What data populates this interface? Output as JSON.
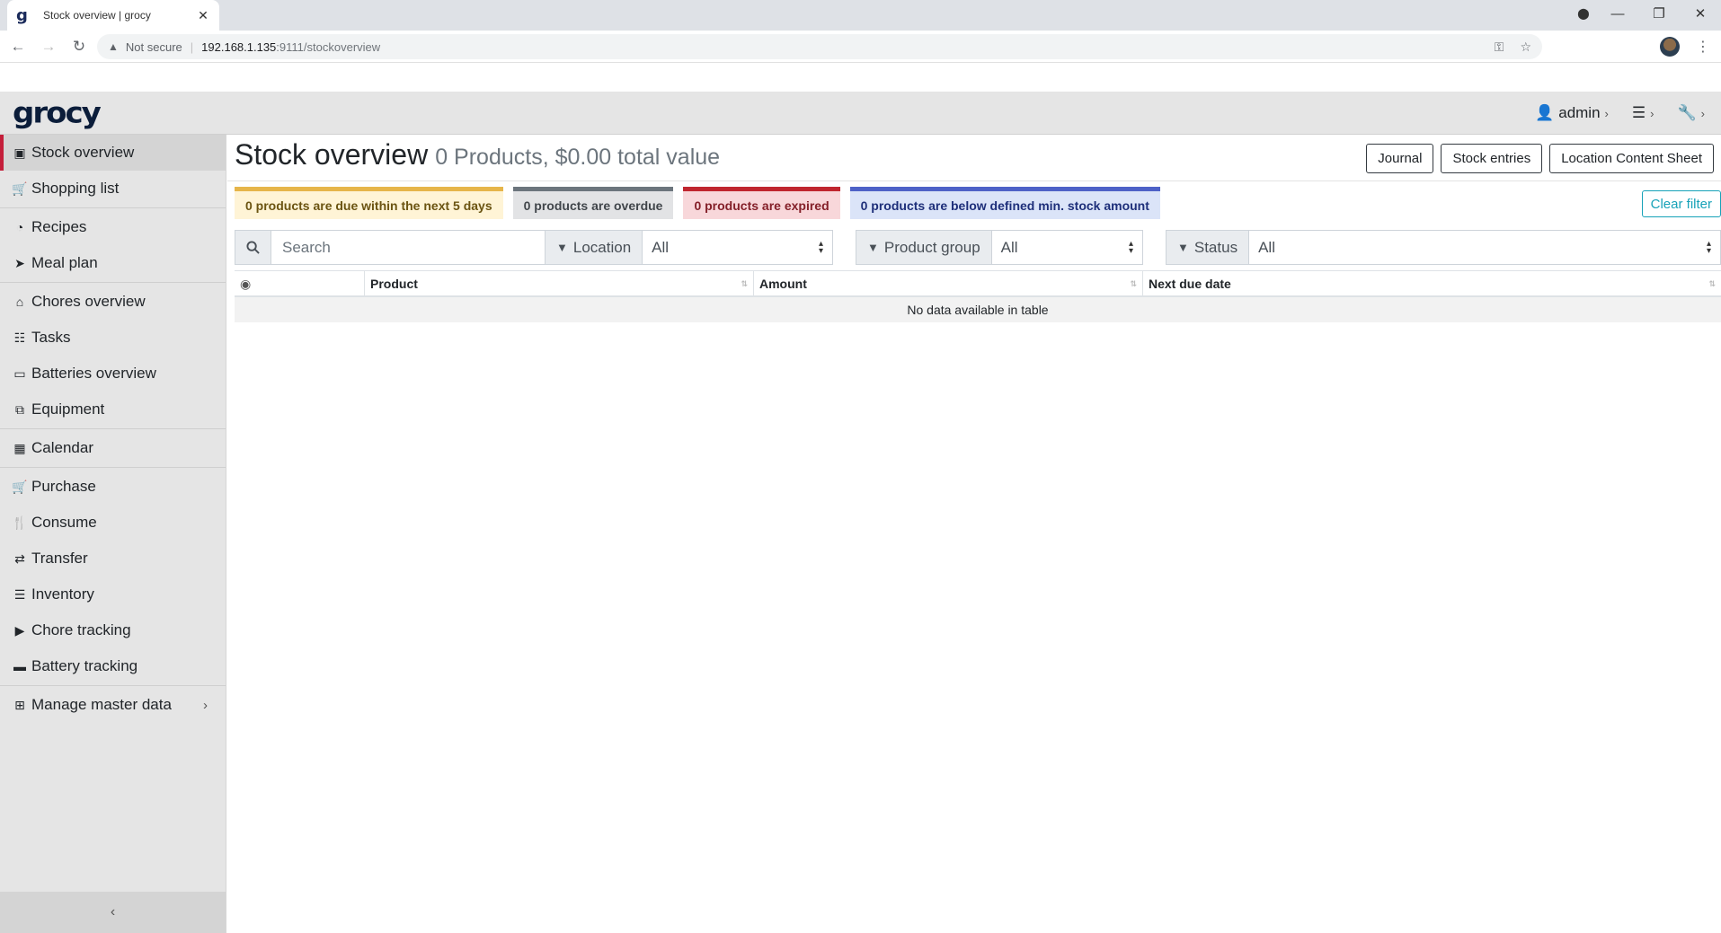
{
  "browser": {
    "tab_title": "Stock overview | grocy",
    "tab_favicon": "g",
    "url_security": "Not secure",
    "url_host": "192.168.1.135",
    "url_path": ":9111/stockoverview"
  },
  "header": {
    "logo": "grocy",
    "user": "admin"
  },
  "sidebar": {
    "items": [
      {
        "label": "Stock overview",
        "icon": "box-icon"
      },
      {
        "label": "Shopping list",
        "icon": "cart-icon"
      },
      {
        "label": "Recipes",
        "icon": "pizza-icon"
      },
      {
        "label": "Meal plan",
        "icon": "paper-plane-icon"
      },
      {
        "label": "Chores overview",
        "icon": "home-icon"
      },
      {
        "label": "Tasks",
        "icon": "tasks-icon"
      },
      {
        "label": "Batteries overview",
        "icon": "battery-icon"
      },
      {
        "label": "Equipment",
        "icon": "toolbox-icon"
      },
      {
        "label": "Calendar",
        "icon": "calendar-icon"
      },
      {
        "label": "Purchase",
        "icon": "cart-plus-icon"
      },
      {
        "label": "Consume",
        "icon": "utensils-icon"
      },
      {
        "label": "Transfer",
        "icon": "exchange-icon"
      },
      {
        "label": "Inventory",
        "icon": "list-icon"
      },
      {
        "label": "Chore tracking",
        "icon": "play-icon"
      },
      {
        "label": "Battery tracking",
        "icon": "car-battery-icon"
      },
      {
        "label": "Manage master data",
        "icon": "table-icon"
      }
    ],
    "collapse_label": "‹"
  },
  "main": {
    "title": "Stock overview",
    "subtitle": "0 Products, $0.00 total value",
    "buttons": {
      "journal": "Journal",
      "stock_entries": "Stock entries",
      "location_content_sheet": "Location Content Sheet"
    },
    "badges": {
      "due": "0 products are due within the next 5 days",
      "overdue": "0 products are overdue",
      "expired": "0 products are expired",
      "below_min": "0 products are below defined min. stock amount"
    },
    "clear_filter": "Clear filter",
    "search": {
      "placeholder": "Search"
    },
    "filters": {
      "location_label": "Location",
      "location_value": "All",
      "product_group_label": "Product group",
      "product_group_value": "All",
      "status_label": "Status",
      "status_value": "All"
    },
    "table": {
      "columns": [
        "Product",
        "Amount",
        "Next due date"
      ],
      "empty_message": "No data available in table"
    }
  },
  "colors": {
    "active_accent": "#c41e3a",
    "due": "#e6b54a",
    "overdue": "#6c757d",
    "expired": "#c0262f",
    "below_min": "#4e62c7",
    "clear_filter": "#17a2b8"
  }
}
